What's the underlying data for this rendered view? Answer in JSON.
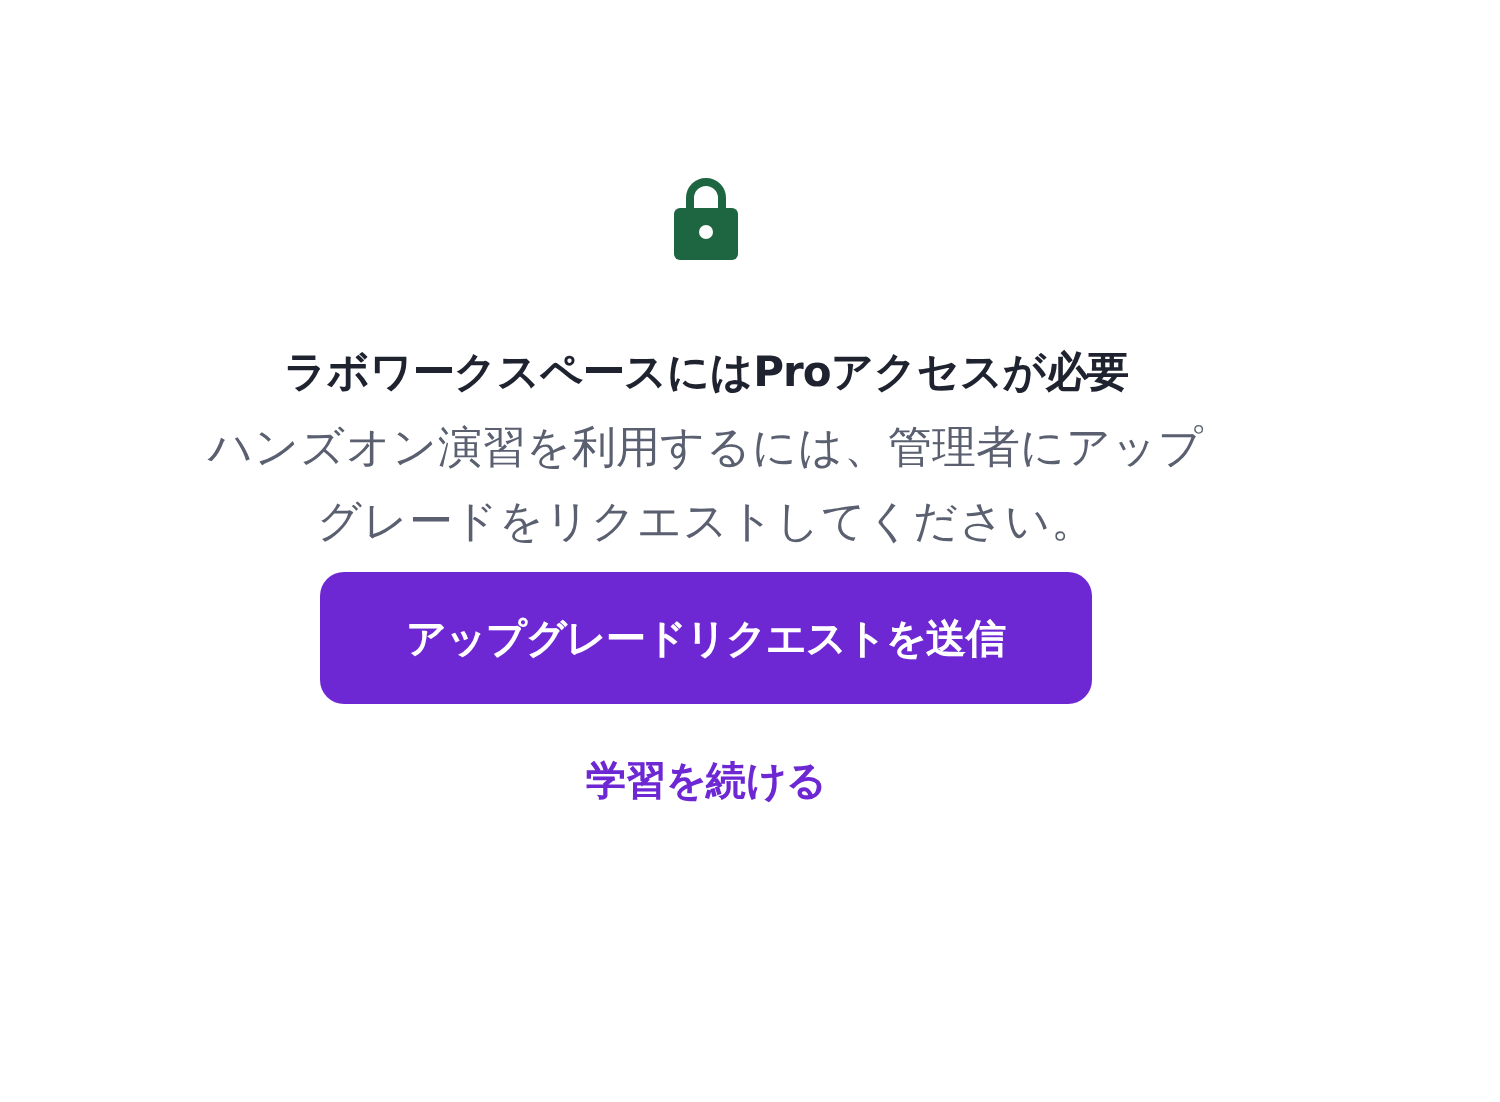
{
  "title": "ラボワークスペースにはProアクセスが必要",
  "message": "ハンズオン演習を利用するには、管理者にアップグレードをリクエストしてください。",
  "primary_button": "アップグレードリクエストを送信",
  "secondary_link": "学習を続ける"
}
